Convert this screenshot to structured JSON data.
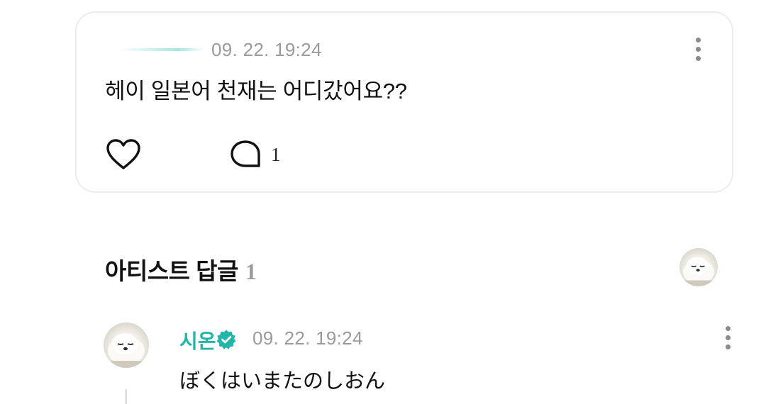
{
  "post": {
    "date": "09. 22. 19:24",
    "text": "헤이 일본어 천재는 어디갔어요??",
    "comment_count": "1"
  },
  "artist_replies": {
    "title": "아티스트 답글",
    "count": "1"
  },
  "reply": {
    "name": "시온",
    "date": "09. 22. 19:24",
    "text": "ぼくはいまたのしおん"
  },
  "icons": {
    "like": "heart-outline-icon",
    "comment": "speech-bubble-icon",
    "more": "more-vertical-icon",
    "verified": "verified-badge-icon",
    "accent": "#22b5ac"
  }
}
